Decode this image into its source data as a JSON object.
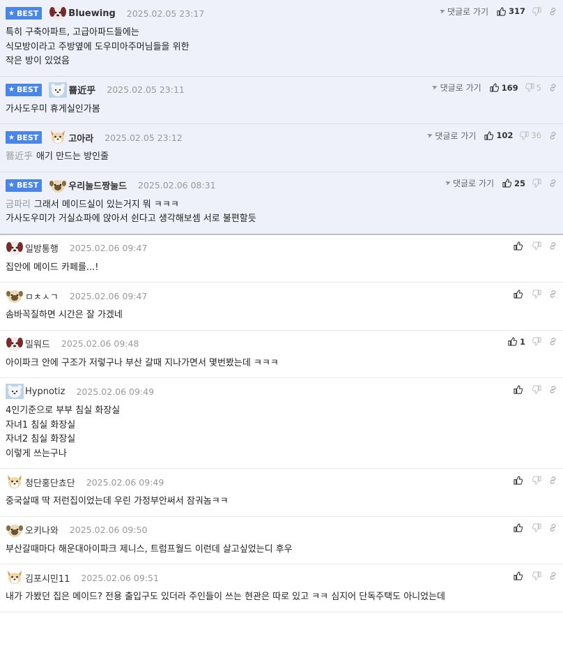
{
  "reply_label": "댓글로 가기",
  "best_label": "BEST",
  "comments": [
    {
      "best": true,
      "avatar": "dog-avatar",
      "nick": "Bluewing",
      "date": "2025.02.05 23:17",
      "up": "317",
      "down": "",
      "reply": true,
      "mention": "",
      "lines": [
        "특히 구축아파트, 고급아파드들에는",
        "식모방이라고 주방옆에 도우미아주머님들을 위한",
        "작은 방이 있었음"
      ]
    },
    {
      "best": true,
      "avatar": "bear-avatar",
      "nick": "罾近乎",
      "date": "2025.02.05 23:11",
      "up": "169",
      "down": "5",
      "reply": true,
      "mention": "",
      "lines": [
        "가사도우미 휴게실인가봄"
      ]
    },
    {
      "best": true,
      "avatar": "fox-avatar",
      "nick": "고아라",
      "date": "2025.02.05 23:12",
      "up": "102",
      "down": "36",
      "reply": true,
      "mention": "罾近乎",
      "lines": [
        "애기 만드는 방인줄"
      ]
    },
    {
      "best": true,
      "avatar": "pug-avatar",
      "nick": "우리눌드짱눌드",
      "date": "2025.02.06 08:31",
      "up": "25",
      "down": "",
      "reply": true,
      "mention": "금파리",
      "lines": [
        "그래서 메이드실이 있는거지 뭐 ㅋㅋㅋ",
        "가사도우미가 거실쇼파에 앉아서 쉰다고 생각해보셈 서로 불편할듯"
      ]
    },
    {
      "best": false,
      "avatar": "dog-avatar",
      "nick": "일방통행",
      "date": "2025.02.06 09:47",
      "up": "",
      "down": "",
      "reply": false,
      "mention": "",
      "lines": [
        "집안에 메이드 카페를...!"
      ]
    },
    {
      "best": false,
      "avatar": "pug-avatar",
      "nick": "ㅁㅊㅅㄱ",
      "date": "2025.02.06 09:47",
      "up": "",
      "down": "",
      "reply": false,
      "mention": "",
      "lines": [
        "솜바꼭질하면 시간은 잘 가겠네"
      ]
    },
    {
      "best": false,
      "avatar": "dog-avatar",
      "nick": "밀워드",
      "date": "2025.02.06 09:48",
      "up": "1",
      "down": "",
      "reply": false,
      "mention": "",
      "lines": [
        "아이파크 안에 구조가 저렇구나 부산 갈때 지나가면서 몇번봤는데 ㅋㅋㅋ"
      ]
    },
    {
      "best": false,
      "avatar": "bear-avatar",
      "nick": "Hypnotiz",
      "date": "2025.02.06 09:49",
      "up": "",
      "down": "",
      "reply": false,
      "mention": "",
      "lines": [
        "4인기준으로 부부 침실 화장실",
        "자녀1 침실 화장실",
        "자녀2 침실 화장실",
        "이렇게 쓰는구나"
      ]
    },
    {
      "best": false,
      "avatar": "fox-avatar",
      "nick": "청단홍단쵸단",
      "date": "2025.02.06 09:49",
      "up": "",
      "down": "",
      "reply": false,
      "mention": "",
      "lines": [
        "중국살때 딱 저런집이었는데 우린 가정부안써서 잠궈놈ㅋㅋ"
      ]
    },
    {
      "best": false,
      "avatar": "pug-avatar",
      "nick": "오키나와",
      "date": "2025.02.06 09:50",
      "up": "",
      "down": "",
      "reply": false,
      "mention": "",
      "lines": [
        "부산갈때마다 해운대아이파크 제니스, 트럼프월드 이런데 살고싶었는디 후우"
      ]
    },
    {
      "best": false,
      "avatar": "fox-avatar",
      "nick": "김포시민11",
      "date": "2025.02.06 09:51",
      "up": "",
      "down": "",
      "reply": false,
      "mention": "",
      "lines": [
        "내가 가봤던 집은 메이드? 전용 출입구도 있더라 주인들이 쓰는 현관은 따로 있고 ㅋㅋ 심지어 단독주택도 아니었는데"
      ]
    }
  ]
}
